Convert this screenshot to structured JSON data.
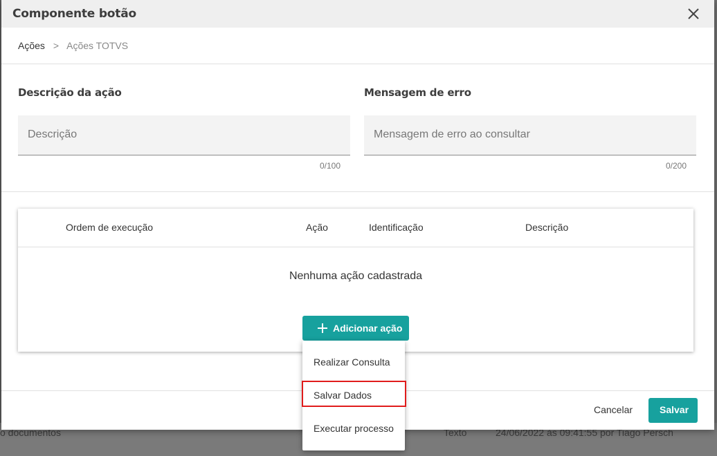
{
  "background": {
    "row_text_left": "o documentos",
    "row_text_type": "Texto",
    "row_text_date": "24/06/2022 às 09:41:55 por Tiago Persch"
  },
  "dialog": {
    "title": "Componente botão",
    "close_icon": "close-icon"
  },
  "breadcrumb": {
    "items": [
      "Ações",
      "Ações TOTVS"
    ],
    "separator": ">"
  },
  "form": {
    "description": {
      "label": "Descrição da ação",
      "placeholder": "Descrição",
      "counter": "0/100"
    },
    "error_message": {
      "label": "Mensagem de erro",
      "placeholder": "Mensagem de erro ao consultar",
      "counter": "0/200"
    }
  },
  "table": {
    "columns": [
      "Ordem de execução",
      "Ação",
      "Identificação",
      "Descrição"
    ],
    "empty_message": "Nenhuma ação cadastrada"
  },
  "add_action": {
    "label": "Adicionar ação",
    "icon": "plus-icon",
    "menu": [
      "Realizar Consulta",
      "Salvar Dados",
      "Executar processo"
    ],
    "highlighted_item": "Salvar Dados"
  },
  "footer": {
    "cancel_label": "Cancelar",
    "save_label": "Salvar"
  },
  "colors": {
    "accent": "#17a19e",
    "highlight": "#e01b1b"
  }
}
